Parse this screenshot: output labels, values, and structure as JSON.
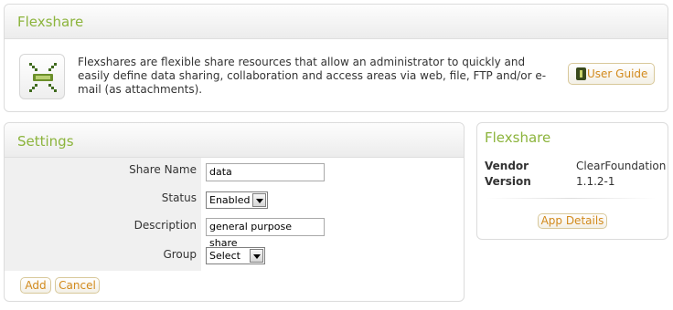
{
  "header": {
    "title": "Flexshare",
    "description": "Flexshares are flexible share resources that allow an administrator to quickly and easily define data sharing, collaboration and access areas via web, file, FTP and/or e-mail (as attachments).",
    "user_guide_label": "User Guide"
  },
  "settings": {
    "title": "Settings",
    "fields": {
      "share_name_label": "Share Name",
      "share_name_value": "data",
      "status_label": "Status",
      "status_value": "Enabled",
      "description_label": "Description",
      "description_value": "general purpose share",
      "group_label": "Group",
      "group_value": "Select"
    },
    "add_label": "Add",
    "cancel_label": "Cancel"
  },
  "info": {
    "title": "Flexshare",
    "vendor_label": "Vendor",
    "vendor_value": "ClearFoundation",
    "version_label": "Version",
    "version_value": "1.1.2-1",
    "app_details_label": "App Details"
  },
  "colors": {
    "accent": "#8cb43c",
    "button_text": "#d28a1c"
  },
  "icons": {
    "app": "flexshare-app-icon",
    "guide": "user-guide-icon"
  }
}
